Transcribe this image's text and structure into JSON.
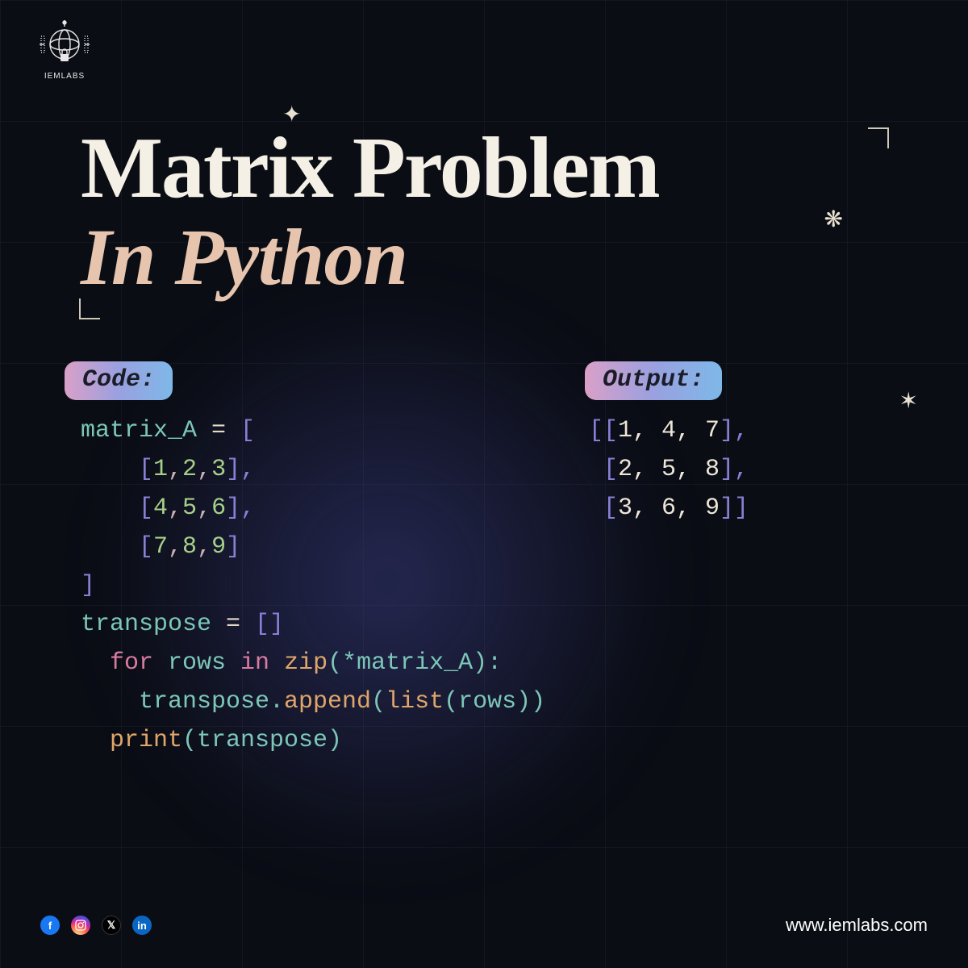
{
  "brand": {
    "name": "IEMLABS"
  },
  "title": {
    "line1": "Matrix Problem",
    "line2": "In Python"
  },
  "labels": {
    "code": "Code:",
    "output": "Output:"
  },
  "code": {
    "l1a": "matrix_A ",
    "l1b": "= ",
    "l1c": "[",
    "l2a": "    [",
    "l2b": "1",
    "l2c": ",",
    "l2d": "2",
    "l2e": ",",
    "l2f": "3",
    "l2g": "],",
    "l3a": "    [",
    "l3b": "4",
    "l3c": ",",
    "l3d": "5",
    "l3e": ",",
    "l3f": "6",
    "l3g": "],",
    "l4a": "    [",
    "l4b": "7",
    "l4c": ",",
    "l4d": "8",
    "l4e": ",",
    "l4f": "9",
    "l4g": "]",
    "l5a": "]",
    "l6a": "transpose ",
    "l6b": "= ",
    "l6c": "[]",
    "l7a": "  for ",
    "l7b": "rows ",
    "l7c": "in ",
    "l7d": "zip",
    "l7e": "(*matrix_A):",
    "l8a": "    transpose.",
    "l8b": "append",
    "l8c": "(",
    "l8d": "list",
    "l8e": "(rows))",
    "l9a": "  print",
    "l9b": "(transpose)"
  },
  "output": {
    "l1a": "[[",
    "l1b": "1, 4, 7",
    "l1c": "],",
    "l2a": " [",
    "l2b": "2, 5, 8",
    "l2c": "],",
    "l3a": " [",
    "l3b": "3, 6, 9",
    "l3c": "]]"
  },
  "footer": {
    "website": "www.iemlabs.com",
    "socials": {
      "facebook": "f",
      "twitter": "𝕏",
      "linkedin": "in"
    }
  }
}
